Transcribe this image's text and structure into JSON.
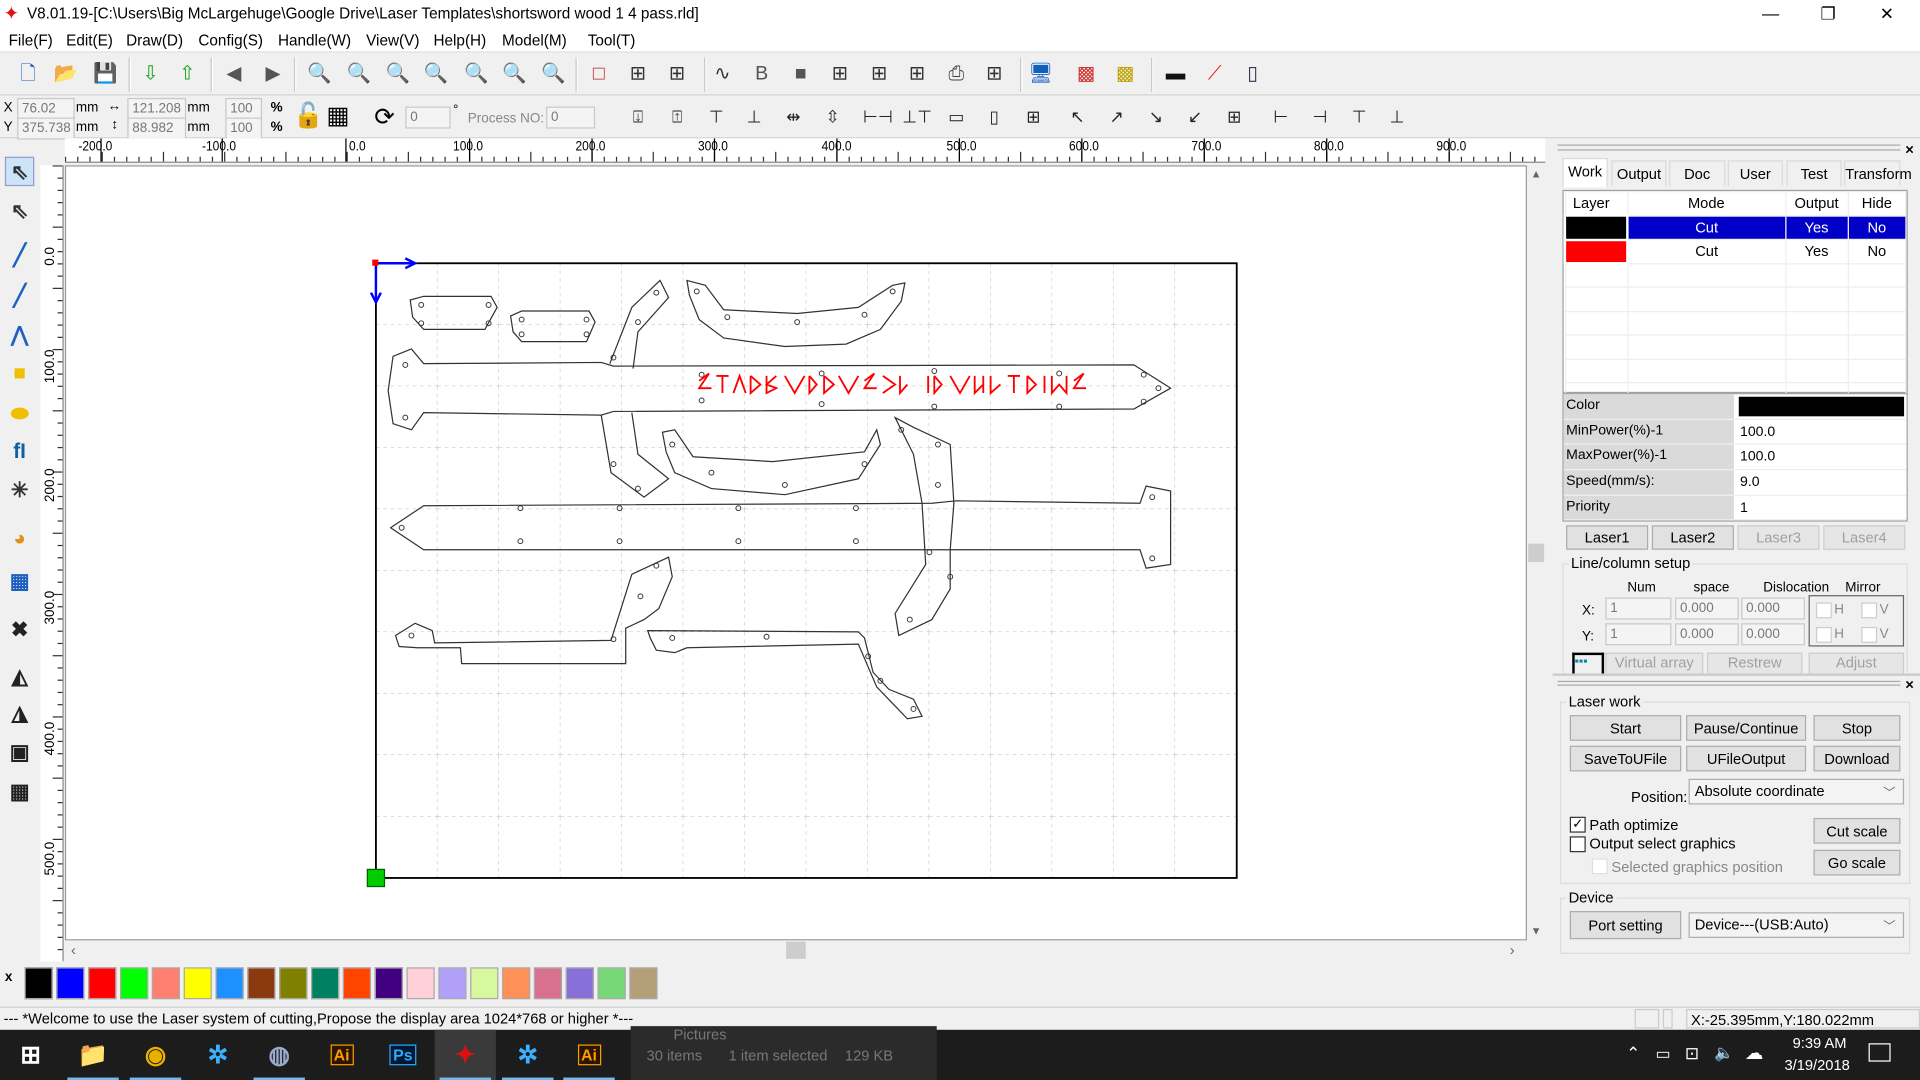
{
  "title": "V8.01.19-[C:\\Users\\Big McLargehuge\\Google Drive\\Laser Templates\\shortsword wood 1 4 pass.rld]",
  "window_controls": {
    "minimize": "—",
    "restore": "❐",
    "close": "✕"
  },
  "menu": [
    "File(F)",
    "Edit(E)",
    "Draw(D)",
    "Config(S)",
    "Handle(W)",
    "View(V)",
    "Help(H)",
    "Model(M)",
    "Tool(T)"
  ],
  "toolbar1_icons": [
    "new-file-icon",
    "open-folder-icon",
    "save-icon",
    "import-icon",
    "export-icon",
    "undo-icon",
    "redo-icon",
    "zoom-pan-icon",
    "zoom-in-icon",
    "zoom-out-icon",
    "zoom-page-icon",
    "zoom-grid-icon",
    "zoom-all-icon",
    "zoom-select-icon",
    "select-frame-icon",
    "node-edit-icon",
    "curve-smooth-icon",
    "curve-icon",
    "bitmap-icon",
    "rectangle-fill-icon",
    "array-icon",
    "align-icon",
    "align-width-icon",
    "print-icon",
    "data-icon",
    "monitor-icon",
    "palette-grid-icon",
    "palette-grid2-icon",
    "camera-icon",
    "laser-pen-icon",
    "ruler-icon"
  ],
  "coords": {
    "x_label": "X",
    "y_label": "Y",
    "x": "76.02",
    "y": "375.738",
    "unit": "mm",
    "width": "121.208",
    "height": "88.982",
    "scale_x": "100",
    "scale_y": "100",
    "percent": "%",
    "rotation": "0",
    "degree": "°",
    "process_label": "Process NO:",
    "process_no": "0"
  },
  "toolbar2_icons": [
    "align-top-icon",
    "align-bottom-icon",
    "align-vcenter-icon",
    "align-hcenter-icon",
    "flip-h-icon",
    "flip-v-icon",
    "space-h-icon",
    "space-v-icon",
    "same-width-icon",
    "same-height-icon",
    "same-size-icon",
    "corner-tl-icon",
    "corner-tr-icon",
    "corner-br-icon",
    "corner-bl-icon",
    "center-icon",
    "align-left-edge-icon",
    "align-right-edge-icon",
    "align-top-edge-icon",
    "align-bottom-edge-icon"
  ],
  "ruler_h": [
    "-200.0",
    "-100.0",
    "0.0",
    "100.0",
    "200.0",
    "300.0",
    "400.0",
    "500.0",
    "600.0",
    "700.0",
    "800.0",
    "900.0"
  ],
  "ruler_v": [
    "0.0",
    "100.0",
    "200.0",
    "300.0",
    "400.0",
    "500.0"
  ],
  "toolbox_icons": [
    "select-arrow-icon",
    "node-select-icon",
    "line-icon",
    "polyline-icon",
    "curve-draw-icon",
    "rectangle-icon",
    "ellipse-icon",
    "text-icon",
    "point-icon",
    "image-icon",
    "grid-array-icon",
    "delete-icon",
    "mirror-h-icon",
    "mirror-v-icon",
    "frame-icon",
    "array-copy-icon"
  ],
  "palette": {
    "close": "x",
    "colors": [
      "#000000",
      "#0000ff",
      "#ff0000",
      "#00ff00",
      "#ff8070",
      "#ffff00",
      "#1e90ff",
      "#8b3a10",
      "#808000",
      "#008060",
      "#ff4500",
      "#400080",
      "#ffd0d8",
      "#b0a0f8",
      "#d8f8a0",
      "#ff9058",
      "#d87090",
      "#8870d8",
      "#78d878",
      "#b4a078"
    ]
  },
  "status": {
    "message": "--- *Welcome to use the Laser system of cutting,Propose the display area 1024*768 or higher *---",
    "cursor": "X:-25.395mm,Y:180.022mm"
  },
  "taskbar": {
    "apps": [
      "start-icon",
      "file-explorer-icon",
      "chrome-icon",
      "battlenet-icon",
      "steam-icon",
      "illustrator-icon",
      "photoshop-icon",
      "rdworks-icon",
      "battlenet2-icon",
      "illustrator2-icon"
    ],
    "ai": "Ai",
    "ps": "Ps",
    "bg_window": {
      "title": "Pictures",
      "items": "30 items",
      "selected": "1 item selected",
      "size": "129 KB"
    },
    "time": "9:39 AM",
    "date": "3/19/2018"
  },
  "panel": {
    "close": "×",
    "tabs": [
      "Work",
      "Output",
      "Doc",
      "User",
      "Test",
      "Transform"
    ],
    "layer_headers": [
      "Layer",
      "Mode",
      "Output",
      "Hide"
    ],
    "layers": [
      {
        "color": "#000000",
        "mode": "Cut",
        "output": "Yes",
        "hide": "No",
        "selected": true
      },
      {
        "color": "#ff0000",
        "mode": "Cut",
        "output": "Yes",
        "hide": "No",
        "selected": false
      }
    ],
    "props": [
      {
        "k": "Color",
        "v": ""
      },
      {
        "k": "MinPower(%)-1",
        "v": "100.0"
      },
      {
        "k": "MaxPower(%)-1",
        "v": "100.0"
      },
      {
        "k": "Speed(mm/s):",
        "v": "9.0"
      },
      {
        "k": "Priority",
        "v": "1"
      }
    ],
    "prop_color": "#000000",
    "laser_buttons": [
      "Laser1",
      "Laser2",
      "Laser3",
      "Laser4"
    ],
    "linecol": {
      "title": "Line/column setup",
      "num": "Num",
      "space": "space",
      "dislocation": "Dislocation",
      "mirror": "Mirror",
      "x": "X:",
      "y": "Y:",
      "x_num": "1",
      "x_space": "0.000",
      "x_disl": "0.000",
      "y_num": "1",
      "y_space": "0.000",
      "y_disl": "0.000",
      "h": "H",
      "v": "V",
      "virtual_array": "Virtual array",
      "restrew": "Restrew",
      "adjust": "Adjust"
    },
    "laser_work": {
      "title": "Laser work",
      "start": "Start",
      "pause": "Pause/Continue",
      "stop": "Stop",
      "save_ufile": "SaveToUFile",
      "ufile_output": "UFileOutput",
      "download": "Download",
      "position_label": "Position:",
      "position": "Absolute coordinate",
      "path_optimize": "Path optimize",
      "output_select": "Output select graphics",
      "selected_pos": "Selected graphics position",
      "cut_scale": "Cut scale",
      "go_scale": "Go scale"
    },
    "device": {
      "title": "Device",
      "port_setting": "Port setting",
      "device": "Device---(USB:Auto)"
    }
  }
}
